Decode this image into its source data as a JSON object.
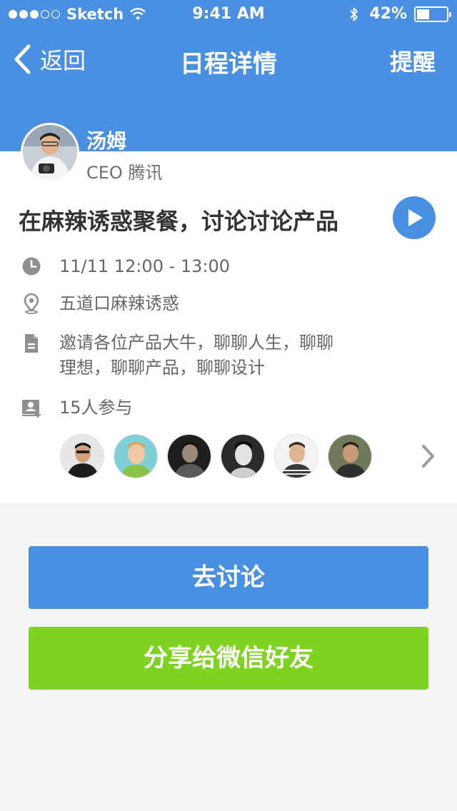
{
  "status_bar": {
    "carrier": "Sketch",
    "time": "9:41 AM",
    "battery_percent": "42%",
    "battery_level": 0.42,
    "signal_full_dots": 3,
    "signal_total_dots": 5
  },
  "nav": {
    "back_label": "返回",
    "title": "日程详情",
    "remind_label": "提醒"
  },
  "host": {
    "name": "汤姆",
    "title": "CEO 腾讯"
  },
  "event": {
    "title": "在麻辣诱惑聚餐，讨论讨论产品",
    "time": "11/11  12:00 - 13:00",
    "location": "五道口麻辣诱惑",
    "description_line1": "邀请各位产品大牛，聊聊人生，聊聊",
    "description_line2": "理想，聊聊产品，聊聊设计",
    "participants_label": "15人参与"
  },
  "participants": [
    {
      "icon": "avatar-1"
    },
    {
      "icon": "avatar-2"
    },
    {
      "icon": "avatar-3"
    },
    {
      "icon": "avatar-4"
    },
    {
      "icon": "avatar-5"
    },
    {
      "icon": "avatar-6"
    }
  ],
  "actions": {
    "discuss_label": "去讨论",
    "share_label": "分享给微信好友"
  },
  "colors": {
    "header_blue": "#4a90e2",
    "share_green": "#7ed321",
    "background": "#f4f4f4"
  }
}
